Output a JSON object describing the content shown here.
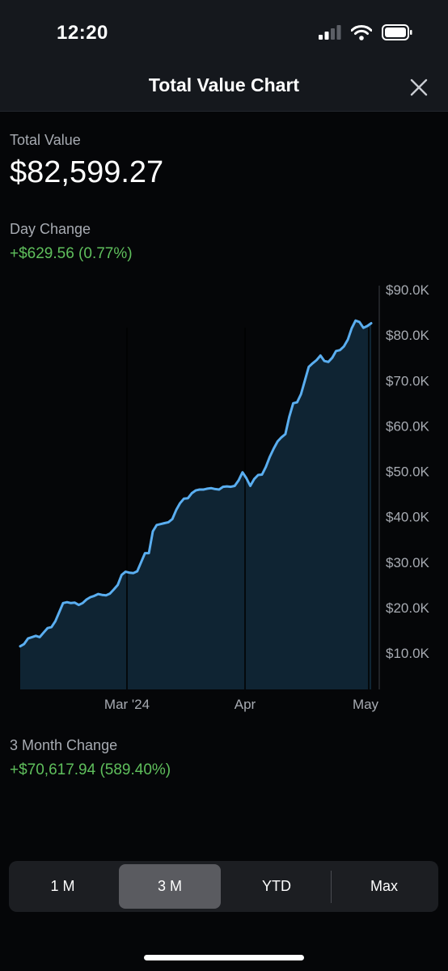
{
  "status": {
    "time": "12:20"
  },
  "header": {
    "title": "Total Value Chart"
  },
  "summary": {
    "total_label": "Total Value",
    "total_value": "$82,599.27",
    "day_change_label": "Day Change",
    "day_change_value": "+$629.56 (0.77%)"
  },
  "chart_data": {
    "type": "area",
    "y_ticks": [
      "$90.0K",
      "$80.0K",
      "$70.0K",
      "$60.0K",
      "$50.0K",
      "$40.0K",
      "$30.0K",
      "$20.0K",
      "$10.0K"
    ],
    "x_ticks": [
      "Mar '24",
      "Apr",
      "May"
    ],
    "ylim": [
      2000,
      90000
    ],
    "y_axis_position": "right",
    "line_color": "#5aaef0",
    "fill_color": "#0f2433",
    "values": [
      11500,
      12000,
      13200,
      13500,
      13800,
      13500,
      14500,
      15500,
      15700,
      17000,
      19000,
      21000,
      21200,
      21000,
      21100,
      20600,
      21000,
      21800,
      22300,
      22600,
      23000,
      22800,
      22700,
      23100,
      24000,
      25000,
      27200,
      27900,
      27700,
      27600,
      28000,
      30000,
      32000,
      32000,
      36800,
      38200,
      38400,
      38600,
      38800,
      39500,
      41500,
      43000,
      44000,
      44100,
      45200,
      45800,
      46000,
      46000,
      46200,
      46300,
      46100,
      46000,
      46600,
      46700,
      46600,
      46800,
      48000,
      49800,
      48500,
      46800,
      48300,
      49200,
      49300,
      51000,
      53200,
      55000,
      56600,
      57500,
      58200,
      62000,
      65000,
      65200,
      67000,
      70000,
      73000,
      73800,
      74500,
      75500,
      74300,
      74100,
      75000,
      76500,
      76700,
      77500,
      79000,
      81500,
      83200,
      82900,
      81600,
      82000,
      82599
    ]
  },
  "period_change": {
    "label": "3 Month Change",
    "value": "+$70,617.94 (589.40%)"
  },
  "range_selector": {
    "options": [
      "1 M",
      "3 M",
      "YTD",
      "Max"
    ],
    "selected": "3 M"
  }
}
